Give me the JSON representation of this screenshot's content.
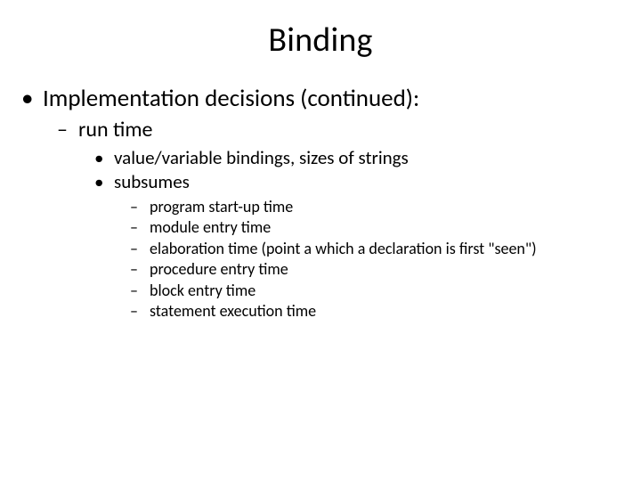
{
  "title": "Binding",
  "bullets": {
    "l1": "Implementation decisions (continued):",
    "l2": "run time",
    "l3a": "value/variable bindings, sizes of strings",
    "l3b": "subsumes",
    "l4": [
      "program start-up time",
      "module entry time",
      "elaboration time (point a which a declaration is first \"seen\")",
      "procedure entry time",
      "block entry time",
      "statement execution time"
    ]
  }
}
